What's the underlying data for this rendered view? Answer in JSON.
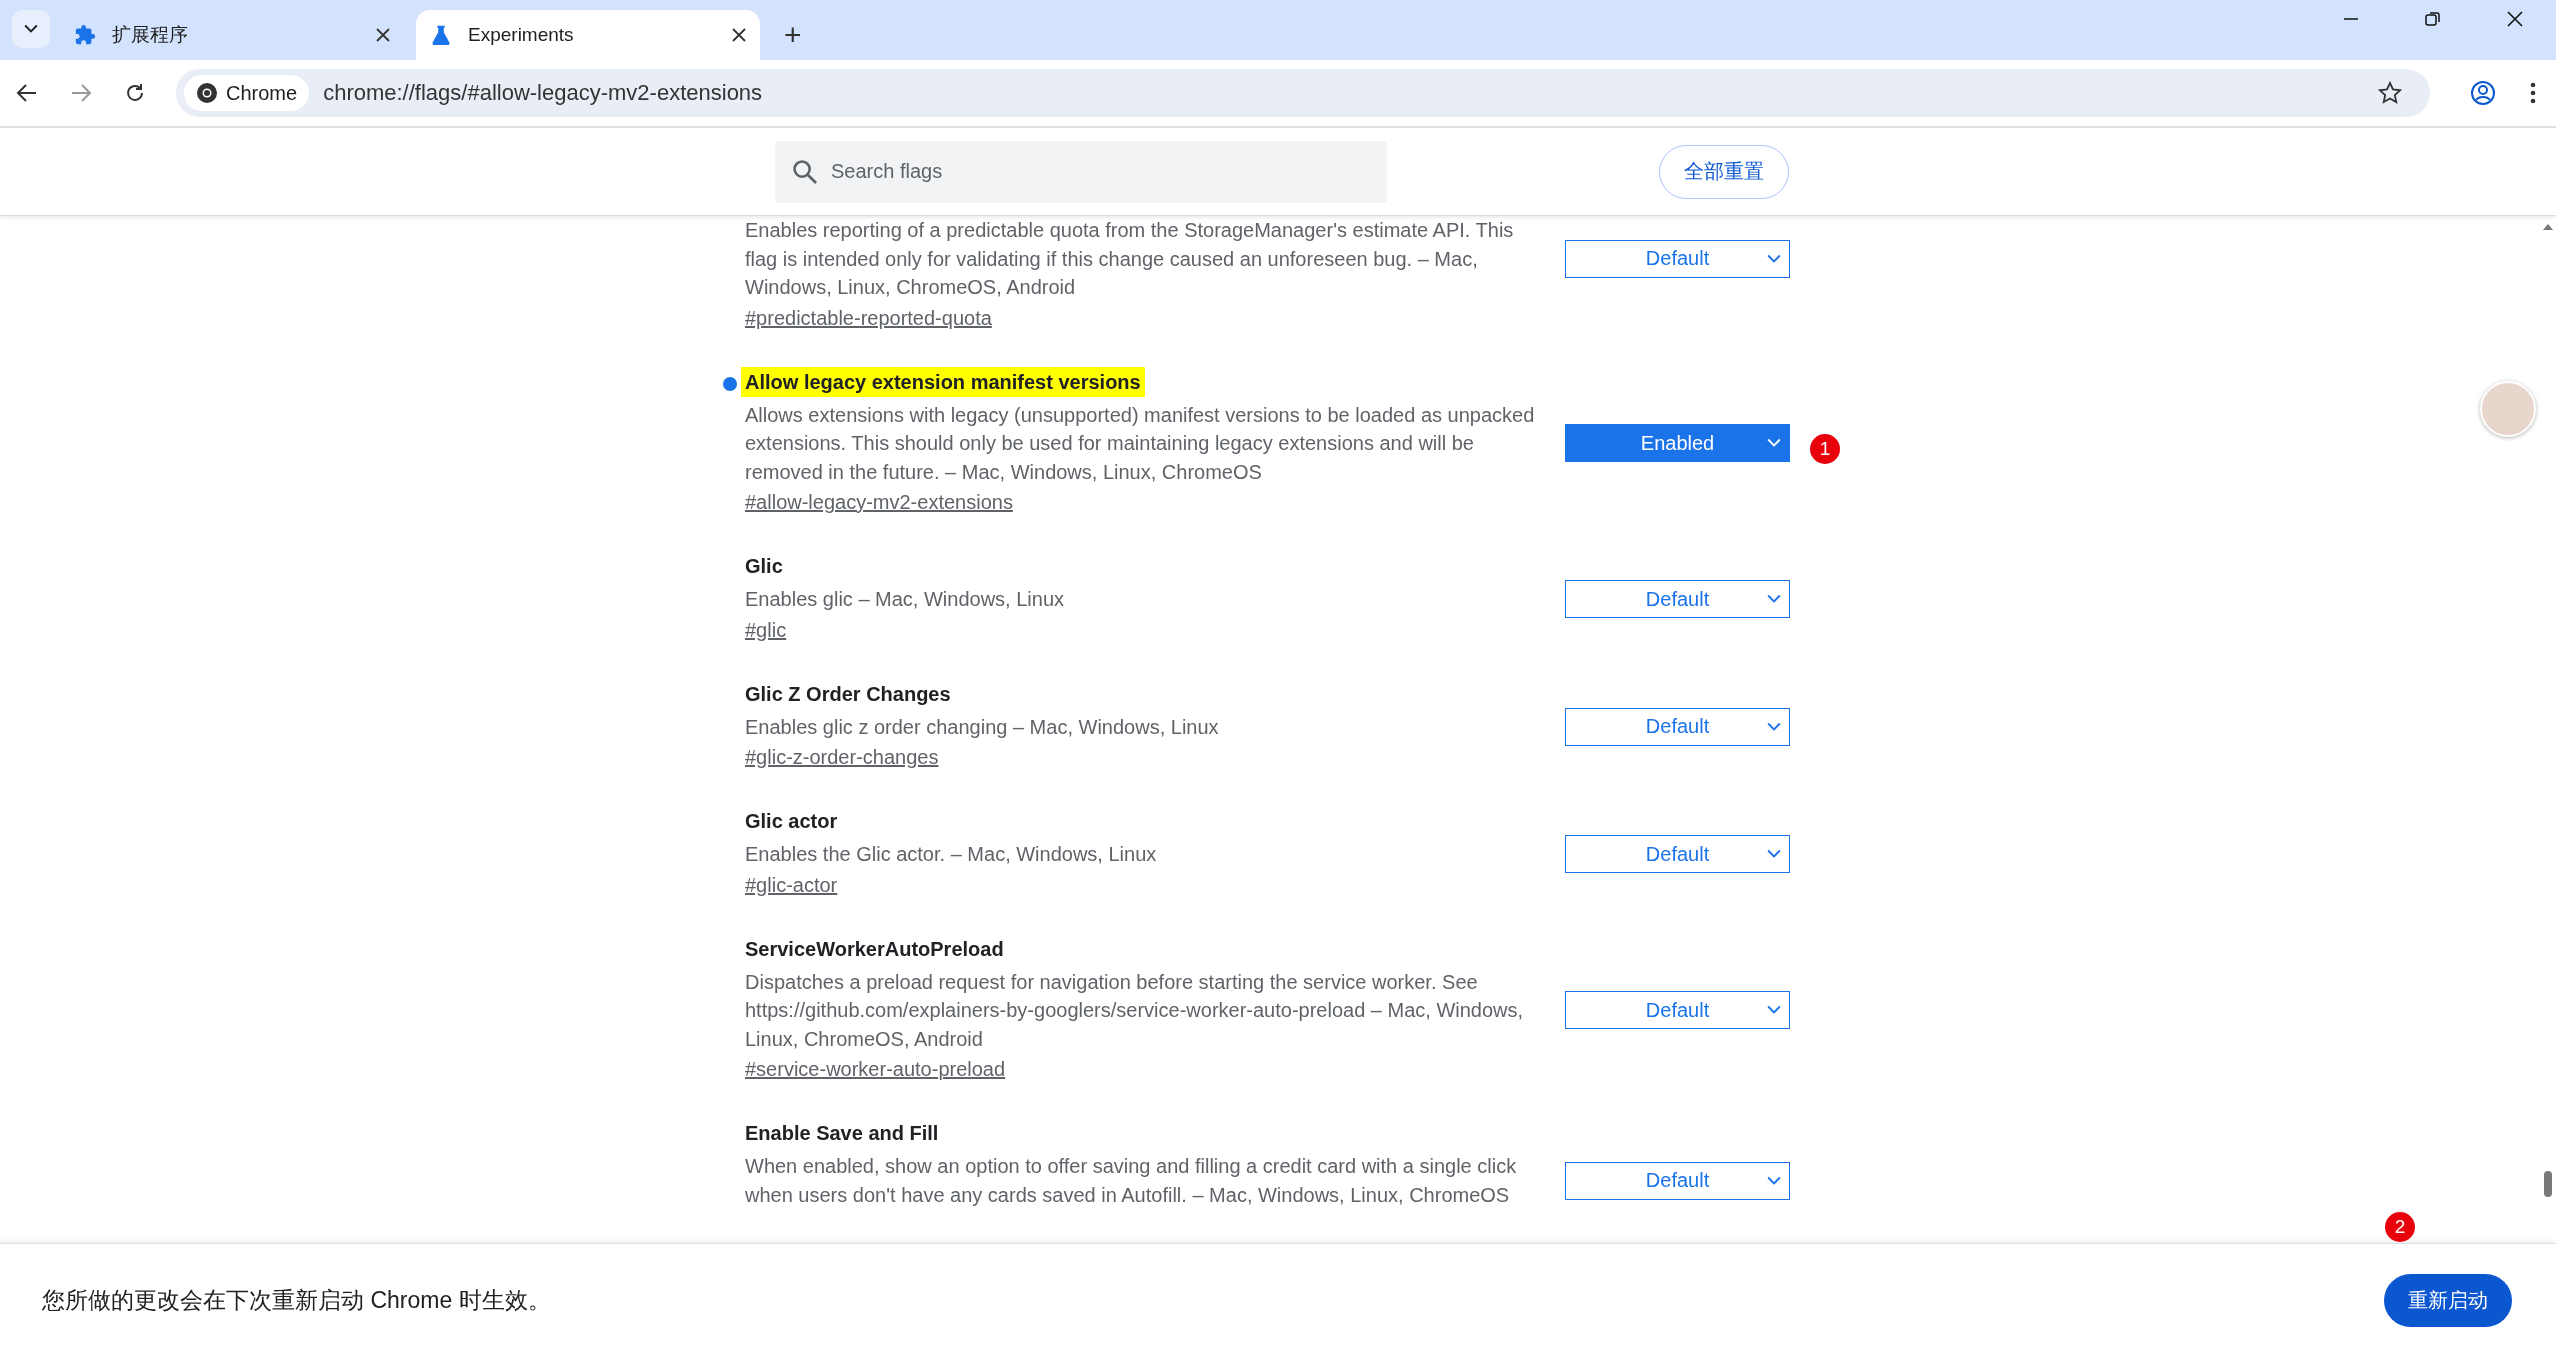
{
  "tabs": [
    {
      "title": "扩展程序",
      "kind": "puzzle",
      "selected": false
    },
    {
      "title": "Experiments",
      "kind": "flask",
      "selected": true
    }
  ],
  "new_tab": "+",
  "omnibox": {
    "chip": "Chrome",
    "url": "chrome://flags/#allow-legacy-mv2-extensions"
  },
  "header": {
    "search_placeholder": "Search flags",
    "reset_button": "全部重置"
  },
  "flags": [
    {
      "description": "Enables reporting of a predictable quota from the StorageManager's estimate API. This flag is intended only for validating if this change caused an unforeseen bug. – Mac, Windows, Linux, ChromeOS, Android",
      "link": "#predictable-reported-quota",
      "value": "Default",
      "modified": false
    },
    {
      "title": "Allow legacy extension manifest versions",
      "description": "Allows extensions with legacy (unsupported) manifest versions to be loaded as unpacked extensions. This should only be used for maintaining legacy extensions and will be removed in the future. – Mac, Windows, Linux, ChromeOS",
      "link": "#allow-legacy-mv2-extensions",
      "value": "Enabled",
      "modified": true,
      "annotation": "1"
    },
    {
      "title": "Glic",
      "description": "Enables glic – Mac, Windows, Linux",
      "link": "#glic",
      "value": "Default",
      "modified": false
    },
    {
      "title": "Glic Z Order Changes",
      "description": "Enables glic z order changing – Mac, Windows, Linux",
      "link": "#glic-z-order-changes",
      "value": "Default",
      "modified": false
    },
    {
      "title": "Glic actor",
      "description": "Enables the Glic actor. – Mac, Windows, Linux",
      "link": "#glic-actor",
      "value": "Default",
      "modified": false
    },
    {
      "title": "ServiceWorkerAutoPreload",
      "description": "Dispatches a preload request for navigation before starting the service worker. See https://github.com/explainers-by-googlers/service-worker-auto-preload – Mac, Windows, Linux, ChromeOS, Android",
      "link": "#service-worker-auto-preload",
      "value": "Default",
      "modified": false
    },
    {
      "title": "Enable Save and Fill",
      "description": "When enabled, show an option to offer saving and filling a credit card with a single click when users don't have any cards saved in Autofill. – Mac, Windows, Linux, ChromeOS",
      "value": "Default",
      "modified": false
    }
  ],
  "footer": {
    "message": "您所做的更改会在下次重新启动 Chrome 时生效。",
    "restart_button": "重新启动"
  },
  "annotations": [
    {
      "text": "2"
    }
  ]
}
